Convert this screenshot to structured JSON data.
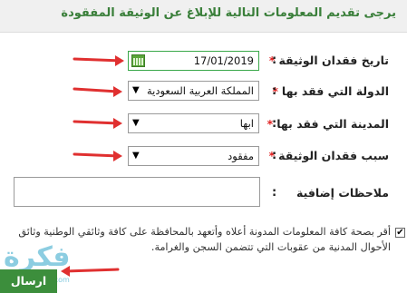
{
  "header": {
    "title": "يرجى تقديم المعلومات التالية للإبلاغ عن الوثيقة المفقودة"
  },
  "form": {
    "loss_date": {
      "label": "تاريخ فقدان الوثيقة",
      "required_mark": "*",
      "colon": ":",
      "value": "17/01/2019",
      "icon": "calendar-icon"
    },
    "country": {
      "label": "الدولة التي فقد بها",
      "required_mark": "*",
      "colon": ":",
      "value": "المملكة العربية السعودية"
    },
    "city": {
      "label": "المدينة التي فقد بها",
      "required_mark": "*",
      "colon": ":",
      "value": "ابها"
    },
    "reason": {
      "label": "سبب فقدان الوثيقة",
      "required_mark": "*",
      "colon": ":",
      "value": "مفقود"
    },
    "notes": {
      "label": "ملاحظات إضافية",
      "colon": ":",
      "value": ""
    }
  },
  "acknowledgement": {
    "checked": true,
    "check_glyph": "✔",
    "text": "أقر بصحة كافة المعلومات المدونة أعلاه وأتعهد بالمحافظة على كافة وثائقي الوطنية وثائق الأحوال المدنية من عقوبات التي تتضمن السجن والغرامة."
  },
  "submit_label": "ارسال",
  "watermark": {
    "text": "فكرة",
    "sub": "fekera.com"
  },
  "colors": {
    "accent": "#3c8e3c",
    "title": "#3a7f3a",
    "required": "#e02020",
    "arrow": "#e03030"
  }
}
